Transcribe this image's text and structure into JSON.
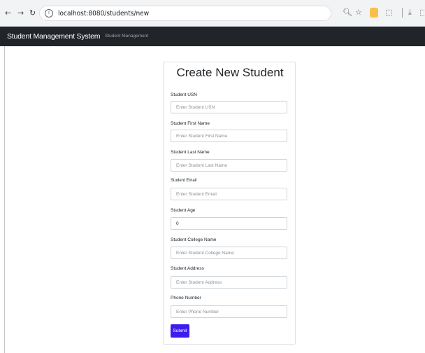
{
  "browser": {
    "url": "localhost:8080/students/new"
  },
  "navbar": {
    "brand": "Student Management System",
    "link": "Student Management"
  },
  "form": {
    "title": "Create New Student",
    "fields": [
      {
        "label": "Student USN",
        "placeholder": "Enter Student USN",
        "value": ""
      },
      {
        "label": "Student First Name",
        "placeholder": "Enter Student First Name",
        "value": ""
      },
      {
        "label": "Student Last Name",
        "placeholder": "Enter Student Last Name",
        "value": ""
      },
      {
        "label": "Student Email",
        "placeholder": "Enter Student Email",
        "value": ""
      },
      {
        "label": "Student Age",
        "placeholder": "",
        "value": "0"
      },
      {
        "label": "Student College Name",
        "placeholder": "Enter Student College Name",
        "value": ""
      },
      {
        "label": "Student Address",
        "placeholder": "Enter Student Address",
        "value": ""
      },
      {
        "label": "Phone Number",
        "placeholder": "Enter Phone Number",
        "value": ""
      }
    ],
    "submit_label": "Submit"
  },
  "colors": {
    "navbar_bg": "#212529",
    "primary": "#3d1cf0"
  }
}
